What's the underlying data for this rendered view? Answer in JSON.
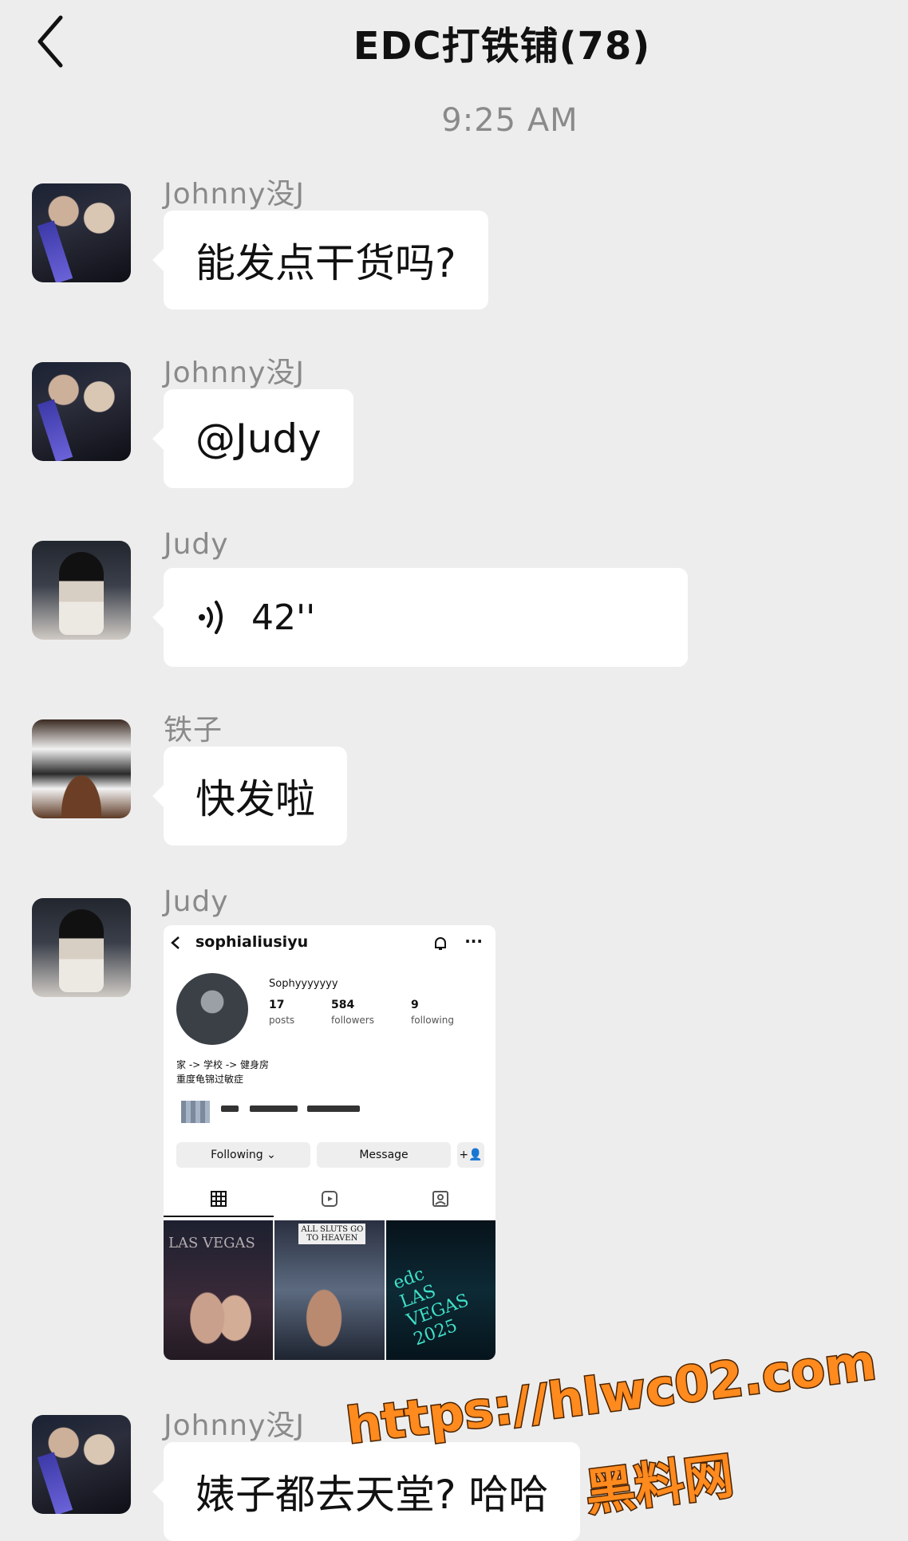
{
  "header": {
    "title": "EDC打铁铺(78)"
  },
  "timestamp": "9:25 AM",
  "messages": [
    {
      "sender": "Johnny没J",
      "text": "能发点干货吗?"
    },
    {
      "sender": "Johnny没J",
      "text": "@Judy"
    },
    {
      "sender": "Judy",
      "voice_duration": "42''"
    },
    {
      "sender": "铁子",
      "text": "快发啦"
    },
    {
      "sender": "Judy"
    },
    {
      "sender": "Johnny没J",
      "text": "婊子都去天堂? 哈哈"
    }
  ],
  "instagram_card": {
    "username": "sophialiusiyu",
    "display_name": "Sophyyyyyyy",
    "stats": [
      {
        "value": "17",
        "label": "posts"
      },
      {
        "value": "584",
        "label": "followers"
      },
      {
        "value": "9",
        "label": "following"
      }
    ],
    "bio_line1": "家 -> 学校 -> 健身房",
    "bio_line2": "重度龟锦过敏症",
    "following_button": "Following",
    "message_button": "Message",
    "thumb1_text": "LAS VEGAS",
    "thumb2_text": "ALL SLUTS GO TO HEAVEN",
    "thumb3_text": "edc LAS VEGAS 2025"
  },
  "watermark": {
    "url": "https://hlwc02.com",
    "name": "黑料网"
  }
}
